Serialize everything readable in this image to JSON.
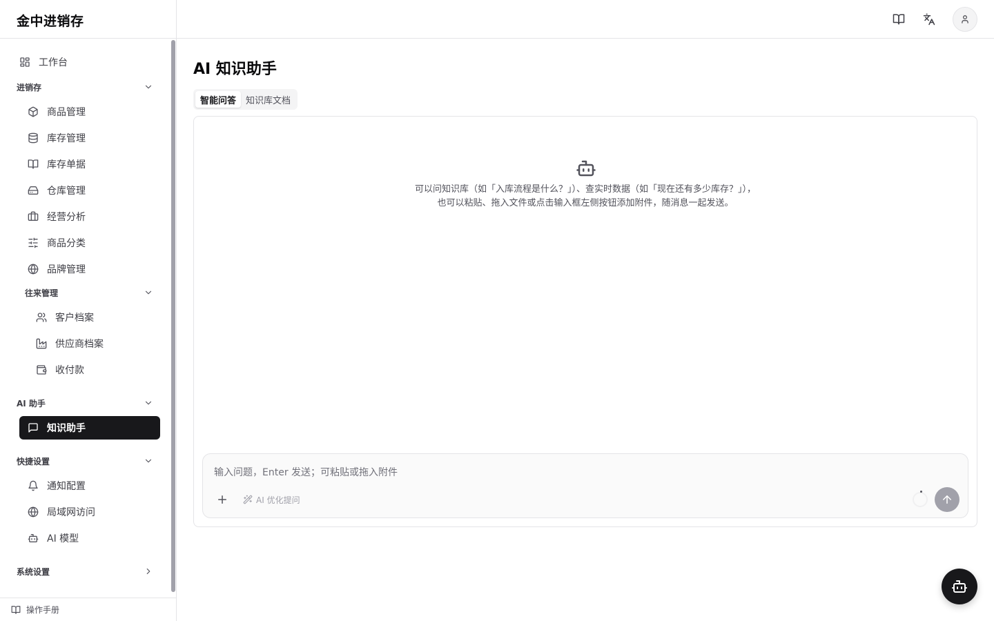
{
  "app": {
    "brand": "金中进销存"
  },
  "sidebar": {
    "workbench": "工作台",
    "groups": {
      "inventory": "进销存",
      "contacts": "往来管理",
      "ai": "AI 助手",
      "quick": "快捷设置",
      "system": "系统设置"
    },
    "inventory_items": [
      {
        "label": "商品管理",
        "icon": "package-icon"
      },
      {
        "label": "库存管理",
        "icon": "database-icon"
      },
      {
        "label": "库存单据",
        "icon": "book-open-icon"
      },
      {
        "label": "仓库管理",
        "icon": "warehouse-icon"
      },
      {
        "label": "经营分析",
        "icon": "briefcase-icon"
      },
      {
        "label": "商品分类",
        "icon": "sliders-icon"
      },
      {
        "label": "品牌管理",
        "icon": "globe-icon"
      }
    ],
    "contact_items": [
      {
        "label": "客户档案",
        "icon": "users-icon"
      },
      {
        "label": "供应商档案",
        "icon": "factory-icon"
      },
      {
        "label": "收付款",
        "icon": "wallet-icon"
      }
    ],
    "ai_items": [
      {
        "label": "知识助手",
        "icon": "message-square-icon",
        "active": true
      }
    ],
    "quick_items": [
      {
        "label": "通知配置",
        "icon": "bell-icon"
      },
      {
        "label": "局域网访问",
        "icon": "globe-icon"
      },
      {
        "label": "AI 模型",
        "icon": "bot-icon"
      }
    ],
    "manual": "操作手册"
  },
  "topbar": {
    "icons": [
      "book-open-icon",
      "languages-icon",
      "user-icon"
    ]
  },
  "main": {
    "title": "AI 知识助手",
    "tabs": [
      {
        "label": "智能问答",
        "active": true
      },
      {
        "label": "知识库文档",
        "active": false
      }
    ],
    "empty": {
      "icon": "bot-icon",
      "line1": "可以问知识库（如「入库流程是什么？」）、查实时数据（如「现在还有多少库存？」），",
      "line2": "也可以粘贴、拖入文件或点击输入框左侧按钮添加附件，随消息一起发送。"
    },
    "composer": {
      "placeholder": "输入问题，Enter 发送；可粘贴或拖入附件",
      "value": "",
      "optimize_label": "AI 优化提问"
    }
  },
  "colors": {
    "accent": "#18181b",
    "border": "#e4e4e7",
    "muted": "#71717a",
    "send_disabled": "#a1a1aa"
  }
}
